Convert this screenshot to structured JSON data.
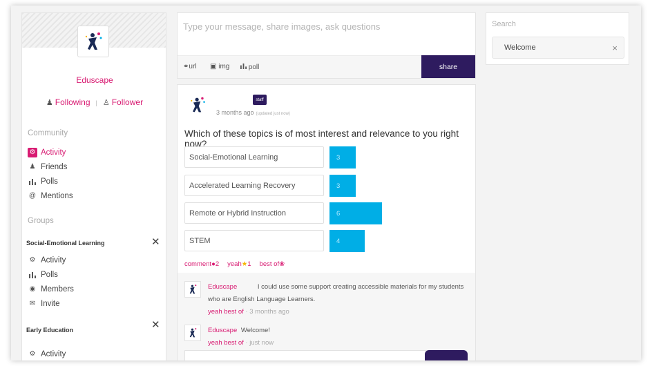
{
  "sidebar": {
    "brand": "Eduscape",
    "following_label": "Following",
    "follower_label": "Follower",
    "community_heading": "Community",
    "community_items": [
      {
        "label": "Activity",
        "icon": "activity-icon",
        "active": true
      },
      {
        "label": "Friends",
        "icon": "friends-icon",
        "active": false
      },
      {
        "label": "Polls",
        "icon": "polls-icon",
        "active": false
      },
      {
        "label": "Mentions",
        "icon": "mentions-icon",
        "active": false
      }
    ],
    "groups_heading": "Groups",
    "groups": [
      {
        "title": "Social-Emotional Learning",
        "items": [
          {
            "label": "Activity",
            "icon": "activity-icon"
          },
          {
            "label": "Polls",
            "icon": "polls-icon"
          },
          {
            "label": "Members",
            "icon": "members-icon"
          },
          {
            "label": "Invite",
            "icon": "invite-icon"
          }
        ]
      },
      {
        "title": "Early Education",
        "items": [
          {
            "label": "Activity",
            "icon": "activity-icon"
          }
        ]
      }
    ]
  },
  "composer": {
    "placeholder": "Type your message, share images, ask questions",
    "tool_url": "url",
    "tool_img": "img",
    "tool_poll": "poll",
    "share_label": "share"
  },
  "post": {
    "badge": "staff",
    "time": "3 months ago",
    "updated": "(updated just now)",
    "question": "Which of these topics is of most interest and relevance to you  right now?",
    "options": [
      {
        "label": "Social-Emotional Learning",
        "votes": 3
      },
      {
        "label": "Accelerated Learning Recovery",
        "votes": 3
      },
      {
        "label": "Remote or Hybrid Instruction",
        "votes": 6
      },
      {
        "label": "STEM",
        "votes": 4
      }
    ],
    "reactions": {
      "comment_label": "comment",
      "comment_count": "2",
      "yeah_label": "yeah",
      "yeah_count": "1",
      "bestof_label": "best of"
    },
    "comments": [
      {
        "author": "Eduscape",
        "text": "I could use some support creating accessible materials for my students who are English Language Learners.",
        "yeah": "yeah",
        "bestof": "best of",
        "time": "3 months ago"
      },
      {
        "author": "Eduscape",
        "text": "Welcome!",
        "yeah": "yeah",
        "bestof": "best of",
        "time": "just now"
      }
    ]
  },
  "search": {
    "label": "Search",
    "value": "Welcome",
    "clear": "×"
  },
  "colors": {
    "accent": "#d81b72",
    "brand_dark": "#2e1b5f",
    "poll_bar": "#00aee6"
  }
}
